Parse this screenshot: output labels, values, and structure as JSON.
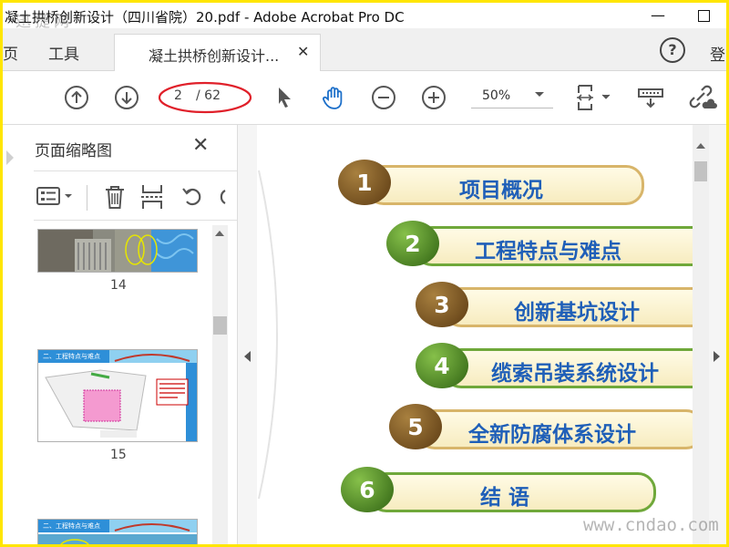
{
  "window": {
    "title": "凝土拱桥创新设计（四川省院）20.pdf - Adobe Acrobat Pro DC",
    "watermark_top": "迅捷网",
    "minimize_icon": "—"
  },
  "tabs": {
    "home": "页",
    "tools": "工具",
    "document": "凝土拱桥创新设计...",
    "close_glyph": "✕",
    "help": "?",
    "login": "登"
  },
  "toolbar": {
    "current_page": "2",
    "total_pages": "/ 62",
    "zoom": "50%",
    "annotation_color": "#e0202a"
  },
  "thumbnails_pane": {
    "title": "页面缩略图",
    "close": "✕",
    "pages": [
      {
        "number": "14"
      },
      {
        "number": "15",
        "caption": "二、工程特点与难点"
      },
      {
        "caption": "二、工程特点与难点"
      }
    ]
  },
  "document": {
    "items": [
      {
        "num": "1",
        "label": "项目概况",
        "ball": "brown"
      },
      {
        "num": "2",
        "label": "工程特点与难点",
        "ball": "green"
      },
      {
        "num": "3",
        "label": "创新基坑设计",
        "ball": "brown"
      },
      {
        "num": "4",
        "label": "缆索吊装系统设计",
        "ball": "green"
      },
      {
        "num": "5",
        "label": "全新防腐体系设计",
        "ball": "brown"
      },
      {
        "num": "6",
        "label": "结  语",
        "ball": "green"
      }
    ],
    "colors": {
      "brown_ball": "#7a5524",
      "green_ball": "#4d8a1e",
      "brown_border": "#d8b56a",
      "green_border": "#6fa83a",
      "label": "#1f5fb8"
    }
  },
  "watermark_bottom": "www.cndao.com",
  "frame_color": "#ffe600"
}
